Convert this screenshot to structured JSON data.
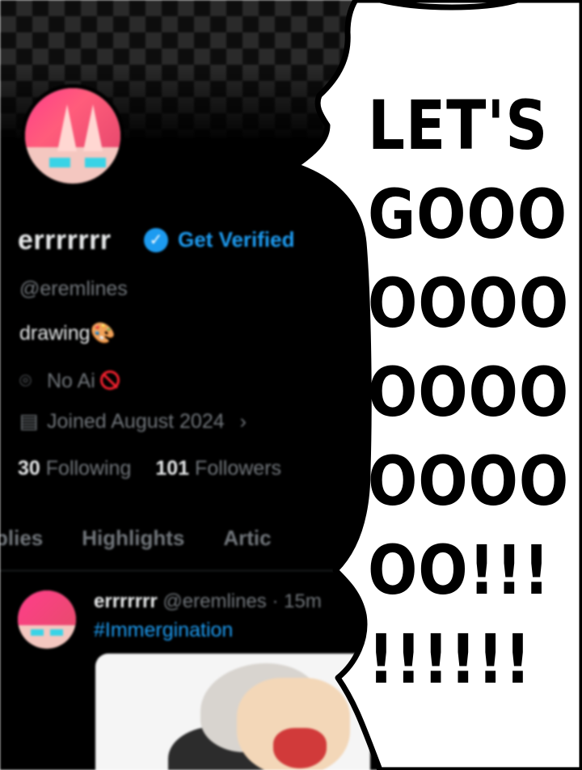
{
  "profile": {
    "display_name": "errrrrrr",
    "verified_icon": "verified-check-icon",
    "get_verified_label": "Get Verified",
    "handle": "@eremlines",
    "bio": "drawing",
    "bio_emoji": "🎨",
    "location": "No Ai",
    "location_icon": "location-pin-icon",
    "no_icon": "prohibited-icon",
    "joined": "Joined August 2024",
    "joined_icon": "calendar-icon",
    "joined_chevron": "›",
    "following_count": "30",
    "following_label": "Following",
    "followers_count": "101",
    "followers_label": "Followers"
  },
  "tabs": [
    "plies",
    "Highlights",
    "Artic"
  ],
  "post": {
    "author": "errrrrrr",
    "handle_time": "@eremlines · 15m",
    "text": "#Immergination"
  },
  "comic": {
    "shout_lines": [
      "LET'S",
      "GOOO",
      "OOOO",
      "OOOO",
      "OOOO",
      "OO!!!",
      "!!!!!!"
    ]
  },
  "colors": {
    "accent": "#1d9bf0",
    "background": "#000000",
    "secondary_text": "#71767b",
    "primary_text": "#e7e9ea"
  }
}
